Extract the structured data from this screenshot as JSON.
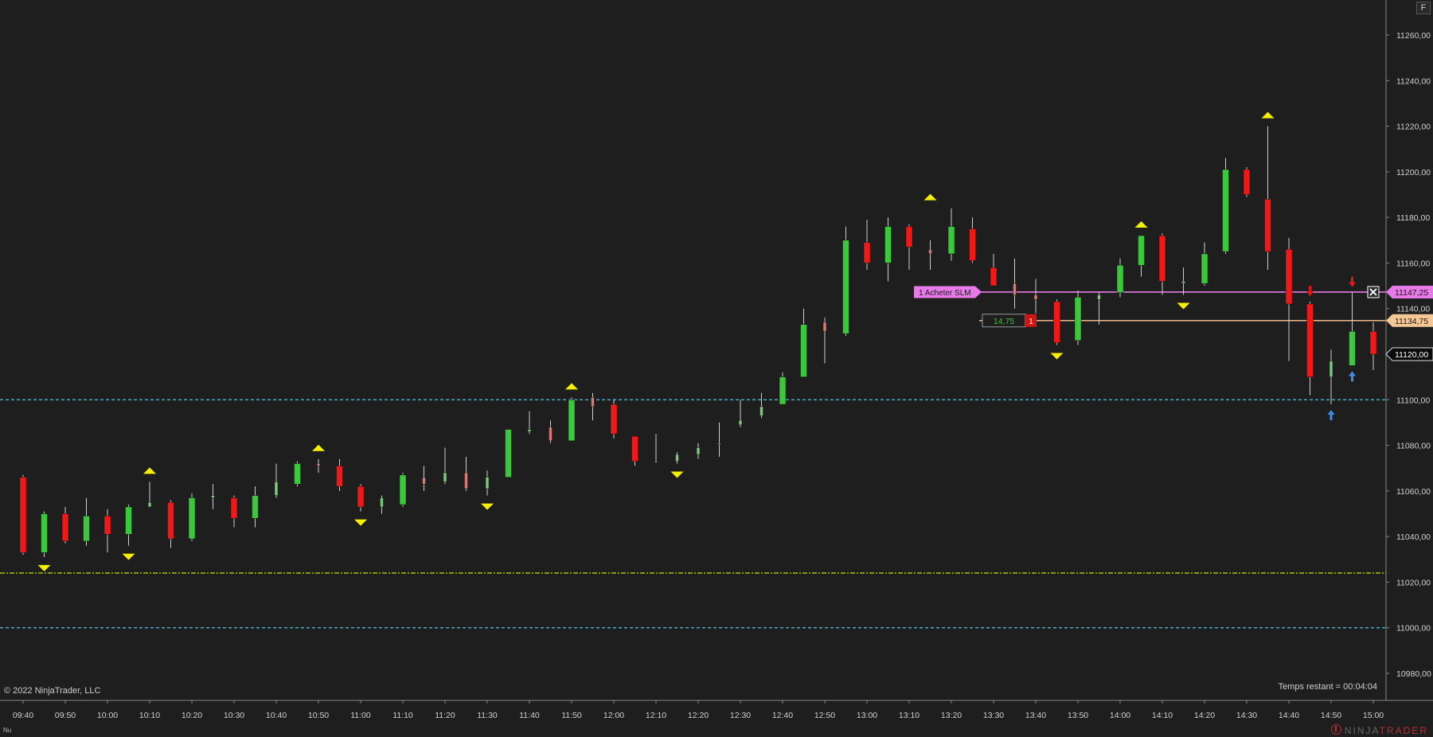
{
  "chart_data": {
    "type": "candlestick",
    "title": "",
    "instrument": "",
    "y_range": [
      10970,
      11270
    ],
    "y_ticks": [
      "11260,00",
      "11240,00",
      "11220,00",
      "11200,00",
      "11180,00",
      "11160,00",
      "11140,00",
      "11120,00",
      "11100,00",
      "11080,00",
      "11060,00",
      "11040,00",
      "11020,00",
      "11000,00",
      "10980,00"
    ],
    "x_ticks": [
      "09:40",
      "09:50",
      "10:00",
      "10:10",
      "10:20",
      "10:30",
      "10:40",
      "10:50",
      "11:00",
      "11:10",
      "11:20",
      "11:30",
      "11:40",
      "11:50",
      "12:00",
      "12:10",
      "12:20",
      "12:30",
      "12:40",
      "12:50",
      "13:00",
      "13:10",
      "13:20",
      "13:30",
      "13:40",
      "13:50",
      "14:00",
      "14:10",
      "14:20",
      "14:30",
      "14:40",
      "14:50",
      "15:00"
    ],
    "bar_interval_minutes": 5,
    "candles": [
      {
        "t": "09:40",
        "o": 11066,
        "h": 11067,
        "l": 11032,
        "c": 11033
      },
      {
        "t": "09:45",
        "o": 11033,
        "h": 11051,
        "l": 11031,
        "c": 11050
      },
      {
        "t": "09:50",
        "o": 11050,
        "h": 11053,
        "l": 11037,
        "c": 11038
      },
      {
        "t": "09:55",
        "o": 11038,
        "h": 11057,
        "l": 11036,
        "c": 11049
      },
      {
        "t": "10:00",
        "o": 11049,
        "h": 11052,
        "l": 11033,
        "c": 11041
      },
      {
        "t": "10:05",
        "o": 11041,
        "h": 11054,
        "l": 11036,
        "c": 11053
      },
      {
        "t": "10:10",
        "o": 11053,
        "h": 11064,
        "l": 11053,
        "c": 11055
      },
      {
        "t": "10:15",
        "o": 11055,
        "h": 11056,
        "l": 11035,
        "c": 11039
      },
      {
        "t": "10:20",
        "o": 11039,
        "h": 11059,
        "l": 11038,
        "c": 11057
      },
      {
        "t": "10:25",
        "o": 11057,
        "h": 11063,
        "l": 11052,
        "c": 11058
      },
      {
        "t": "10:30",
        "o": 11057,
        "h": 11058,
        "l": 11044,
        "c": 11048
      },
      {
        "t": "10:35",
        "o": 11048,
        "h": 11062,
        "l": 11044,
        "c": 11058
      },
      {
        "t": "10:40",
        "o": 11058,
        "h": 11072,
        "l": 11057,
        "c": 11064
      },
      {
        "t": "10:45",
        "o": 11063,
        "h": 11073,
        "l": 11062,
        "c": 11072
      },
      {
        "t": "10:50",
        "o": 11072,
        "h": 11074,
        "l": 11068,
        "c": 11071
      },
      {
        "t": "10:55",
        "o": 11071,
        "h": 11074,
        "l": 11060,
        "c": 11062
      },
      {
        "t": "11:00",
        "o": 11062,
        "h": 11063,
        "l": 11051,
        "c": 11053
      },
      {
        "t": "11:05",
        "o": 11053,
        "h": 11058,
        "l": 11050,
        "c": 11057
      },
      {
        "t": "11:10",
        "o": 11054,
        "h": 11068,
        "l": 11053,
        "c": 11067
      },
      {
        "t": "11:15",
        "o": 11066,
        "h": 11071,
        "l": 11060,
        "c": 11063
      },
      {
        "t": "11:20",
        "o": 11064,
        "h": 11079,
        "l": 11063,
        "c": 11068
      },
      {
        "t": "11:25",
        "o": 11068,
        "h": 11075,
        "l": 11060,
        "c": 11061
      },
      {
        "t": "11:30",
        "o": 11061,
        "h": 11069,
        "l": 11058,
        "c": 11066
      },
      {
        "t": "11:35",
        "o": 11066,
        "h": 11087,
        "l": 11066,
        "c": 11087
      },
      {
        "t": "11:40",
        "o": 11086,
        "h": 11095,
        "l": 11085,
        "c": 11087
      },
      {
        "t": "11:45",
        "o": 11088,
        "h": 11091,
        "l": 11081,
        "c": 11082
      },
      {
        "t": "11:50",
        "o": 11082,
        "h": 11101,
        "l": 11082,
        "c": 11100
      },
      {
        "t": "11:55",
        "o": 11101,
        "h": 11103,
        "l": 11091,
        "c": 11097
      },
      {
        "t": "12:00",
        "o": 11098,
        "h": 11100,
        "l": 11083,
        "c": 11085
      },
      {
        "t": "12:05",
        "o": 11084,
        "h": 11084,
        "l": 11071,
        "c": 11073
      },
      {
        "t": "12:10",
        "o": 11073,
        "h": 11085,
        "l": 11073,
        "c": 11073
      },
      {
        "t": "12:15",
        "o": 11073,
        "h": 11077,
        "l": 11072,
        "c": 11076
      },
      {
        "t": "12:20",
        "o": 11076,
        "h": 11081,
        "l": 11074,
        "c": 11079
      },
      {
        "t": "12:25",
        "o": 11081,
        "h": 11090,
        "l": 11075,
        "c": 11081
      },
      {
        "t": "12:30",
        "o": 11089,
        "h": 11100,
        "l": 11088,
        "c": 11091
      },
      {
        "t": "12:35",
        "o": 11093,
        "h": 11103,
        "l": 11092,
        "c": 11097
      },
      {
        "t": "12:40",
        "o": 11098,
        "h": 11112,
        "l": 11098,
        "c": 11110
      },
      {
        "t": "12:45",
        "o": 11110,
        "h": 11140,
        "l": 11110,
        "c": 11133
      },
      {
        "t": "12:50",
        "o": 11134,
        "h": 11136,
        "l": 11116,
        "c": 11130
      },
      {
        "t": "12:55",
        "o": 11129,
        "h": 11176,
        "l": 11128,
        "c": 11170
      },
      {
        "t": "13:00",
        "o": 11169,
        "h": 11179,
        "l": 11157,
        "c": 11160
      },
      {
        "t": "13:05",
        "o": 11160,
        "h": 11180,
        "l": 11152,
        "c": 11176
      },
      {
        "t": "13:10",
        "o": 11176,
        "h": 11177,
        "l": 11157,
        "c": 11167
      },
      {
        "t": "13:15",
        "o": 11166,
        "h": 11170,
        "l": 11157,
        "c": 11164
      },
      {
        "t": "13:20",
        "o": 11164,
        "h": 11184,
        "l": 11161,
        "c": 11176
      },
      {
        "t": "13:25",
        "o": 11175,
        "h": 11180,
        "l": 11160,
        "c": 11161
      },
      {
        "t": "13:30",
        "o": 11158,
        "h": 11164,
        "l": 11151,
        "c": 11150
      },
      {
        "t": "13:35",
        "o": 11151,
        "h": 11162,
        "l": 11140,
        "c": 11146
      },
      {
        "t": "13:40",
        "o": 11146,
        "h": 11153,
        "l": 11138,
        "c": 11144
      },
      {
        "t": "13:45",
        "o": 11143,
        "h": 11144,
        "l": 11124,
        "c": 11125
      },
      {
        "t": "13:50",
        "o": 11126,
        "h": 11148,
        "l": 11124,
        "c": 11145
      },
      {
        "t": "13:55",
        "o": 11144,
        "h": 11147,
        "l": 11133,
        "c": 11146
      },
      {
        "t": "14:00",
        "o": 11147,
        "h": 11162,
        "l": 11145,
        "c": 11159
      },
      {
        "t": "14:05",
        "o": 11159,
        "h": 11172,
        "l": 11154,
        "c": 11172
      },
      {
        "t": "14:10",
        "o": 11172,
        "h": 11173,
        "l": 11146,
        "c": 11152
      },
      {
        "t": "14:15",
        "o": 11151,
        "h": 11158,
        "l": 11146,
        "c": 11152
      },
      {
        "t": "14:20",
        "o": 11151,
        "h": 11169,
        "l": 11150,
        "c": 11164
      },
      {
        "t": "14:25",
        "o": 11165,
        "h": 11206,
        "l": 11164,
        "c": 11201
      },
      {
        "t": "14:30",
        "o": 11201,
        "h": 11202,
        "l": 11189,
        "c": 11190
      },
      {
        "t": "14:35",
        "o": 11188,
        "h": 11220,
        "l": 11157,
        "c": 11165
      },
      {
        "t": "14:40",
        "o": 11166,
        "h": 11171,
        "l": 11117,
        "c": 11142
      },
      {
        "t": "14:45",
        "o": 11142,
        "h": 11143,
        "l": 11102,
        "c": 11110
      },
      {
        "t": "14:50",
        "o": 11110,
        "h": 11122,
        "l": 11098,
        "c": 11117
      },
      {
        "t": "14:55",
        "o": 11115,
        "h": 11147,
        "l": 11115,
        "c": 11130
      },
      {
        "t": "15:00",
        "o": 11130,
        "h": 11134,
        "l": 11113,
        "c": 11120
      }
    ],
    "swing_markers": [
      {
        "t": "09:45",
        "dir": "down",
        "price": 11031
      },
      {
        "t": "10:05",
        "dir": "down",
        "price": 11036
      },
      {
        "t": "10:10",
        "dir": "up",
        "price": 11064
      },
      {
        "t": "10:50",
        "dir": "up",
        "price": 11074
      },
      {
        "t": "11:00",
        "dir": "down",
        "price": 11051
      },
      {
        "t": "11:30",
        "dir": "down",
        "price": 11058
      },
      {
        "t": "11:50",
        "dir": "up",
        "price": 11101
      },
      {
        "t": "12:15",
        "dir": "down",
        "price": 11072
      },
      {
        "t": "13:15",
        "dir": "up",
        "price": 11184
      },
      {
        "t": "13:45",
        "dir": "down",
        "price": 11124
      },
      {
        "t": "14:05",
        "dir": "up",
        "price": 11172
      },
      {
        "t": "14:15",
        "dir": "down",
        "price": 11146
      },
      {
        "t": "14:35",
        "dir": "up",
        "price": 11220
      }
    ],
    "signal_arrows": [
      {
        "t": "14:45",
        "dir": "down",
        "color": "#e01818",
        "price": 11143
      },
      {
        "t": "14:55",
        "dir": "down",
        "color": "#e01818",
        "price": 11147
      },
      {
        "t": "14:50",
        "dir": "up",
        "color": "#3b8fe6",
        "price": 11098
      },
      {
        "t": "14:55",
        "dir": "up",
        "color": "#3b8fe6",
        "price": 11115
      }
    ],
    "horizontal_lines": [
      {
        "price": 11100,
        "style": "dashed",
        "color": "#4cc3e8"
      },
      {
        "price": 11000,
        "style": "dashed",
        "color": "#4cc3e8"
      },
      {
        "price": 11024,
        "style": "dashdot",
        "color": "#b9e800"
      },
      {
        "price": 11147.25,
        "style": "solid",
        "color": "#e879e8"
      },
      {
        "price": 11134.75,
        "style": "solid",
        "color": "#f0b98a"
      }
    ],
    "order": {
      "quantity": "1",
      "label": "Acheter SLM",
      "price_label": "11147,25",
      "color": "#e879e8"
    },
    "position": {
      "pnl": "14,75",
      "quantity": "1",
      "price_label": "11134,75",
      "color": "#f5c896"
    },
    "last_price_label": "11120,00",
    "colors": {
      "background": "#1e1e1e",
      "up": "#3cc83c",
      "down": "#f01818",
      "up_small": "#7ec87e",
      "down_small": "#d87878",
      "swing": "#f5f000",
      "grid_text": "#d0d0d0"
    }
  },
  "copyright": "© 2022 NinjaTrader, LLC",
  "countdown": "Temps restant = 00:04:04",
  "corner_button": "F",
  "bottom_left_label": "Nu",
  "brand": {
    "part1": "NINJA",
    "part2": "TRADER"
  }
}
